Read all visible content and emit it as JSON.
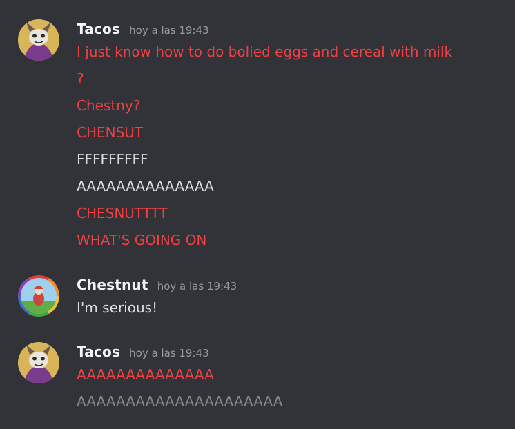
{
  "groups": [
    {
      "username": "Tacos",
      "timestamp": "hoy a las 19:43",
      "lines": [
        {
          "text": "I just know how to do bolied eggs and cereal with milk",
          "color": "#f23f42"
        },
        {
          "text": "?",
          "color": "#f23f42"
        },
        {
          "text": "Chestny?",
          "color": "#f23f42"
        },
        {
          "text": "CHENSUT",
          "color": "#f23f42"
        },
        {
          "text": "FFFFFFFFF",
          "color": "#dbdee1"
        },
        {
          "text": "AAAAAAAAAAAAAA",
          "color": "#dbdee1"
        },
        {
          "text": "CHESNUTTTT",
          "color": "#f23f42"
        },
        {
          "text": "WHAT'S GOING ON",
          "color": "#f23f42"
        }
      ]
    },
    {
      "username": "Chestnut",
      "timestamp": "hoy a las 19:43",
      "lines": [
        {
          "text": "I'm serious!",
          "color": "#dbdee1"
        }
      ]
    },
    {
      "username": "Tacos",
      "timestamp": "hoy a las 19:43",
      "lines": [
        {
          "text": "AAAAAAAAAAAAAA",
          "color": "#f23f42"
        },
        {
          "text": "AAAAAAAAAAAAAAAAAAAAA",
          "color": "#87898c"
        }
      ]
    }
  ]
}
